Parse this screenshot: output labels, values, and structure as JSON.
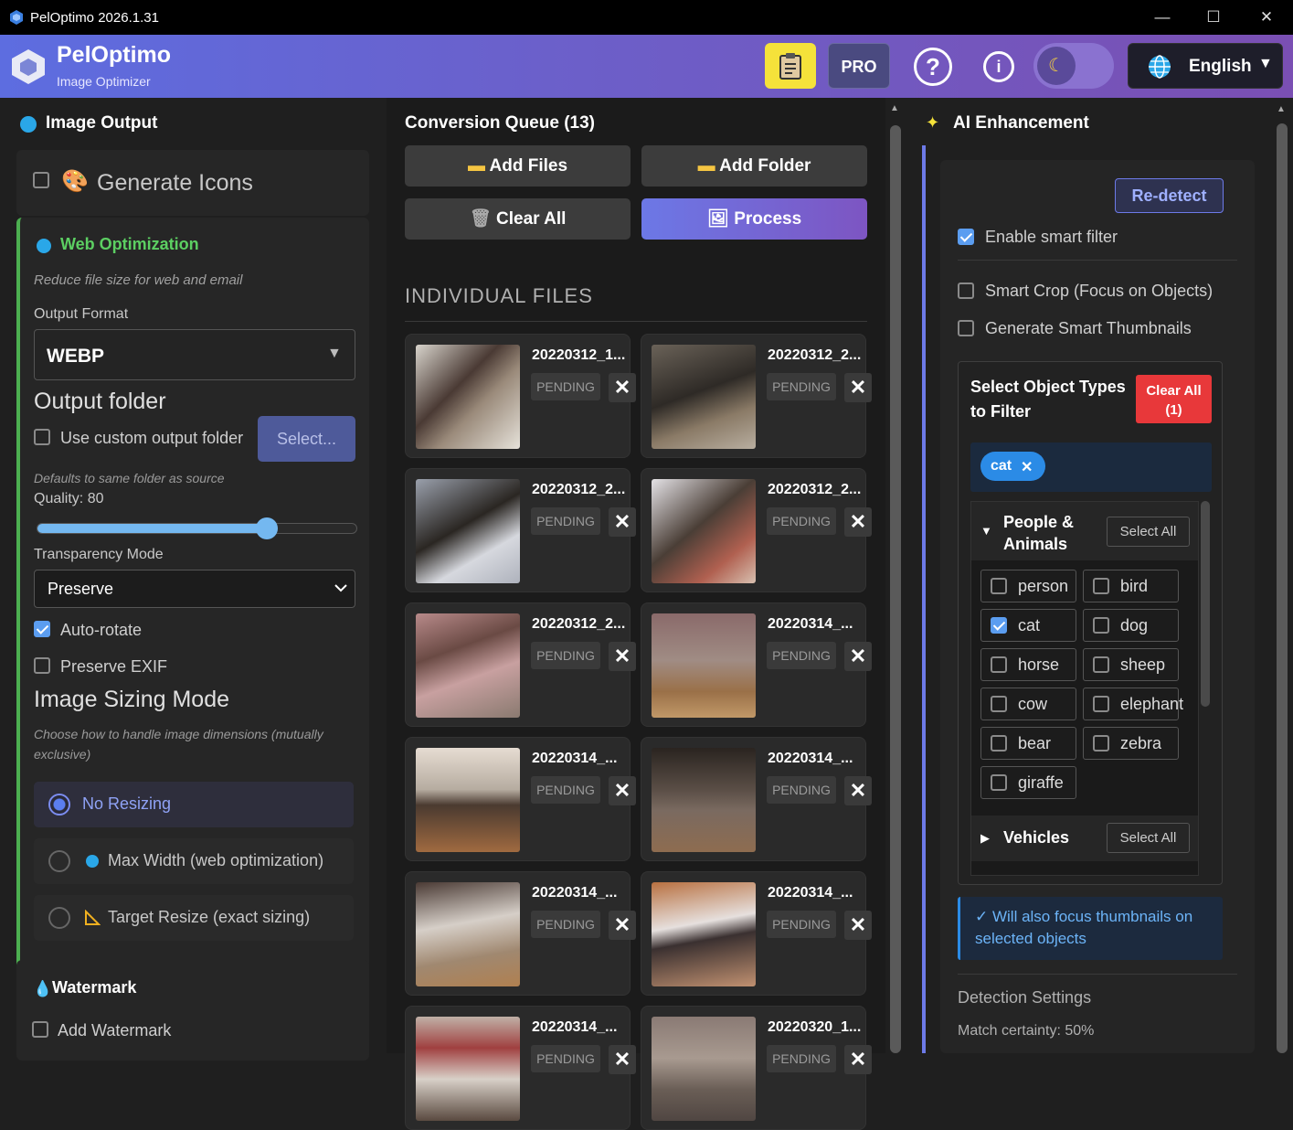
{
  "window": {
    "title": "PelOptimo 2026.1.31",
    "minimize": "—",
    "maximize": "☐",
    "close": "✕"
  },
  "header": {
    "app_name": "PelOptimo",
    "subtitle": "Image Optimizer",
    "pro_label": "PRO",
    "help_label": "?",
    "info_label": "i",
    "language": "English"
  },
  "left": {
    "title": "Image Output",
    "generate_icons": "Generate Icons",
    "web_opt": {
      "title": "Web Optimization",
      "desc": "Reduce file size for web and email",
      "format_label": "Output Format",
      "format_value": "WEBP",
      "folder_heading": "Output folder",
      "custom_folder": "Use custom output folder",
      "select_btn": "Select...",
      "defaults_note": "Defaults to same folder as source",
      "quality_label": "Quality: 80",
      "quality_value": 80,
      "transparency_label": "Transparency Mode",
      "transparency_value": "Preserve",
      "auto_rotate": "Auto-rotate",
      "preserve_exif": "Preserve EXIF",
      "sizing_heading": "Image Sizing Mode",
      "sizing_desc": "Choose how to handle image dimensions (mutually exclusive)",
      "sizing_options": [
        "No Resizing",
        "Max Width (web optimization)",
        "Target Resize (exact sizing)"
      ],
      "sizing_selected": "No Resizing"
    },
    "watermark": {
      "title": "Watermark",
      "add": "Add Watermark"
    }
  },
  "queue": {
    "title": "Conversion Queue (13)",
    "add_files": "Add Files",
    "add_folder": "Add Folder",
    "clear_all": "Clear All",
    "process": "Process",
    "section": "INDIVIDUAL FILES",
    "files": [
      {
        "name": "20220312_1...",
        "status": "PENDING"
      },
      {
        "name": "20220312_2...",
        "status": "PENDING"
      },
      {
        "name": "20220312_2...",
        "status": "PENDING"
      },
      {
        "name": "20220312_2...",
        "status": "PENDING"
      },
      {
        "name": "20220312_2...",
        "status": "PENDING"
      },
      {
        "name": "20220314_...",
        "status": "PENDING"
      },
      {
        "name": "20220314_...",
        "status": "PENDING"
      },
      {
        "name": "20220314_...",
        "status": "PENDING"
      },
      {
        "name": "20220314_...",
        "status": "PENDING"
      },
      {
        "name": "20220314_...",
        "status": "PENDING"
      },
      {
        "name": "20220314_...",
        "status": "PENDING"
      },
      {
        "name": "20220320_1...",
        "status": "PENDING"
      }
    ],
    "remove_glyph": "✕"
  },
  "ai": {
    "title": "AI Enhancement",
    "redetect": "Re-detect",
    "smart_filter": "Enable smart filter",
    "smart_crop": "Smart Crop (Focus on Objects)",
    "smart_thumbs": "Generate Smart Thumbnails",
    "select_types": "Select Object Types to Filter",
    "clear_all": "Clear All",
    "clear_count": "(1)",
    "chip": "cat",
    "chip_close": "✕",
    "group1": {
      "name": "People & Animals",
      "select_all": "Select All",
      "items": [
        "person",
        "bird",
        "cat",
        "dog",
        "horse",
        "sheep",
        "cow",
        "elephant",
        "bear",
        "zebra",
        "giraffe"
      ],
      "checked": [
        "cat"
      ]
    },
    "group2": {
      "name": "Vehicles",
      "select_all": "Select All"
    },
    "notice": "✓ Will also focus thumbnails on selected objects",
    "detection_heading": "Detection Settings",
    "certainty": "Match certainty: 50%"
  },
  "colors": {
    "accent": "#6d7ae8",
    "danger": "#e8383a",
    "green": "#4caf50",
    "yellow": "#f5e23a"
  }
}
